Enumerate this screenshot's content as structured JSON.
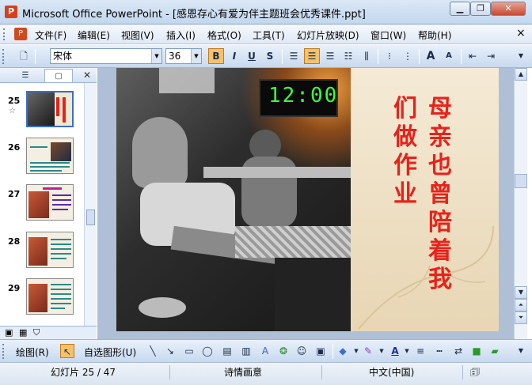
{
  "window": {
    "title": "Microsoft Office PowerPoint - [感恩存心有爱为伴主题班会优秀课件.ppt]",
    "app_icon": "P",
    "minimize_icon": "minimize-icon",
    "restore_icon": "restore-icon",
    "close_icon": "close-icon"
  },
  "menubar": {
    "items": [
      {
        "label": "文件(F)"
      },
      {
        "label": "编辑(E)"
      },
      {
        "label": "视图(V)"
      },
      {
        "label": "插入(I)"
      },
      {
        "label": "格式(O)"
      },
      {
        "label": "工具(T)"
      },
      {
        "label": "幻灯片放映(D)"
      },
      {
        "label": "窗口(W)"
      },
      {
        "label": "帮助(H)"
      }
    ],
    "close_icon": "×"
  },
  "toolbar": {
    "font_name": "宋体",
    "font_size": "36",
    "bold": "B",
    "italic": "I",
    "underline": "U",
    "shadow": "S",
    "increase_font": "A",
    "decrease_font": "A"
  },
  "slides_panel": {
    "thumbs": [
      {
        "num": "25",
        "star": "☆"
      },
      {
        "num": "26",
        "star": ""
      },
      {
        "num": "27",
        "star": ""
      },
      {
        "num": "28",
        "star": ""
      },
      {
        "num": "29",
        "star": ""
      }
    ]
  },
  "slide": {
    "clock": "12:00",
    "line1": "母亲也曾陪着我",
    "line2": "们做作业"
  },
  "drawbar": {
    "draw_label": "绘图(R)",
    "autoshapes_label": "自选图形(U)"
  },
  "status": {
    "slide_pos": "幻灯片 25 / 47",
    "design": "诗情画意",
    "language": "中文(中国)"
  },
  "colors": {
    "accent": "#3a6fc4",
    "slide_text": "#e8221a",
    "clock": "#3cff3c"
  }
}
